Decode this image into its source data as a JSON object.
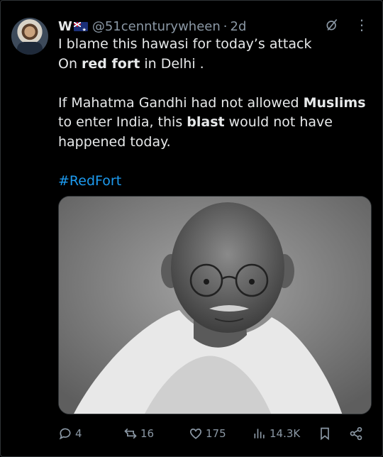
{
  "post": {
    "display_name": "W",
    "handle": "@51cennturywheen",
    "separator": "·",
    "time": "2d",
    "lines": {
      "line1": "I blame this hawasi for today’s attack",
      "line2_pre": "On ",
      "line2_bold": "red fort",
      "line2_post": " in Delhi .",
      "para2_a": "If Mahatma Gandhi had not allowed ",
      "para2_b": "Muslims",
      "para2_c": " to enter India, this ",
      "para2_d": "blast",
      "para2_e": " would not have happened today."
    },
    "hashtag": "#RedFort"
  },
  "actions": {
    "replies": "4",
    "reposts": "16",
    "likes": "175",
    "views": "14.3K"
  },
  "icons": {
    "flag": "australia-flag-icon",
    "grok": "grok-icon",
    "more": "more-icon",
    "reply": "reply-icon",
    "repost": "repost-icon",
    "like": "heart-icon",
    "views": "views-icon",
    "bookmark": "bookmark-icon",
    "share": "share-icon"
  },
  "colors": {
    "background": "#000000",
    "text": "#e7e9ea",
    "muted": "#8b98a5",
    "link": "#1d9bf0"
  }
}
